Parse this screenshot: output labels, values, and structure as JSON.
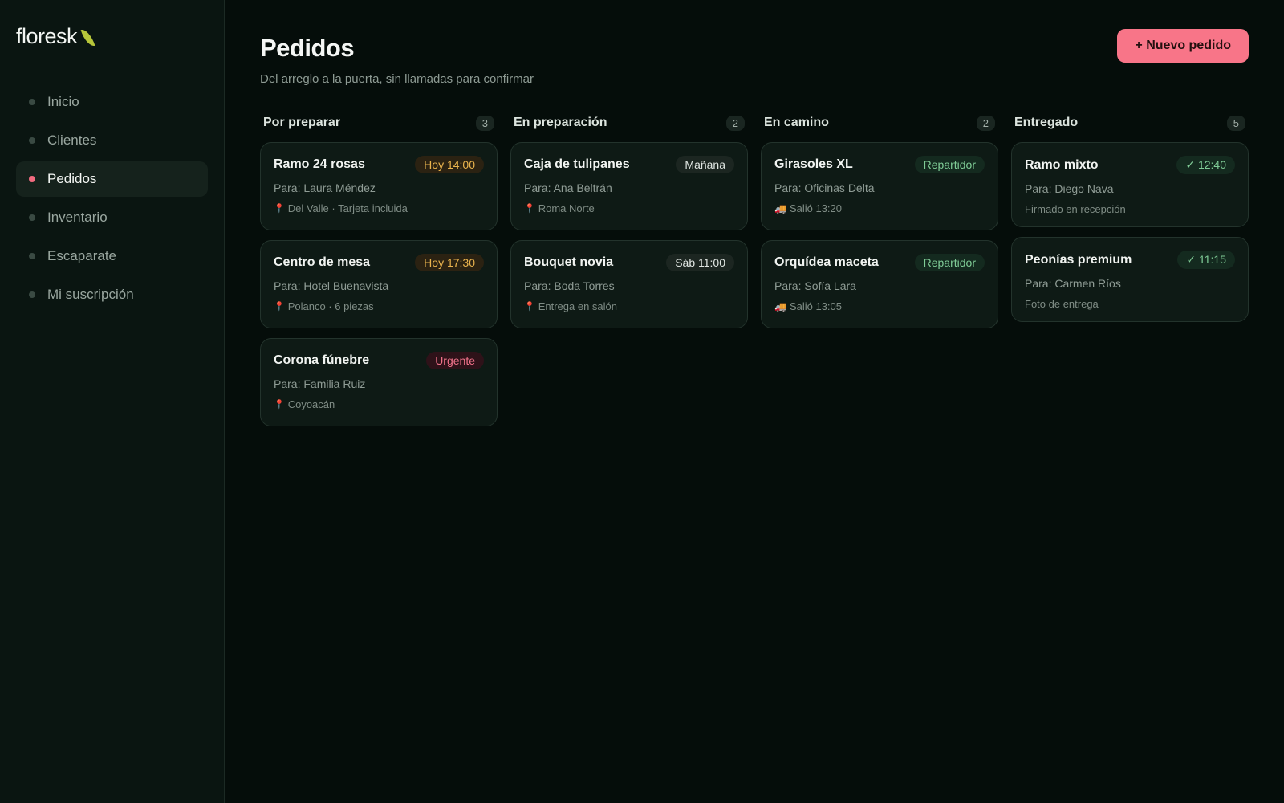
{
  "brand": {
    "name": "floresk"
  },
  "sidebar": {
    "items": [
      {
        "label": "Inicio"
      },
      {
        "label": "Clientes"
      },
      {
        "label": "Pedidos"
      },
      {
        "label": "Inventario"
      },
      {
        "label": "Escaparate"
      },
      {
        "label": "Mi suscripción"
      }
    ]
  },
  "header": {
    "title": "Pedidos",
    "subtitle": "Del arreglo a la puerta, sin llamadas para confirmar",
    "new_button": "+ Nuevo pedido"
  },
  "columns": [
    {
      "title": "Por preparar",
      "count": "3",
      "cards": [
        {
          "title": "Ramo 24 rosas",
          "badge": "Hoy 14:00",
          "to": "Para: Laura Méndez",
          "meta": "Del Valle · Tarjeta incluida"
        },
        {
          "title": "Centro de mesa",
          "badge": "Hoy 17:30",
          "to": "Para: Hotel Buenavista",
          "meta": "Polanco · 6 piezas"
        },
        {
          "title": "Corona fúnebre",
          "badge": "Urgente",
          "to": "Para: Familia Ruiz",
          "meta": "Coyoacán"
        }
      ]
    },
    {
      "title": "En preparación",
      "count": "2",
      "cards": [
        {
          "title": "Caja de tulipanes",
          "badge": "Mañana",
          "to": "Para: Ana Beltrán",
          "meta": "Roma Norte"
        },
        {
          "title": "Bouquet novia",
          "badge": "Sáb 11:00",
          "to": "Para: Boda Torres",
          "meta": "Entrega en salón"
        }
      ]
    },
    {
      "title": "En camino",
      "count": "2",
      "cards": [
        {
          "title": "Girasoles XL",
          "badge": "Repartidor",
          "to": "Para: Oficinas Delta",
          "meta": "Salió 13:20"
        },
        {
          "title": "Orquídea maceta",
          "badge": "Repartidor",
          "to": "Para: Sofía Lara",
          "meta": "Salió 13:05"
        }
      ]
    },
    {
      "title": "Entregado",
      "count": "5",
      "cards": [
        {
          "title": "Ramo mixto",
          "badge": "✓ 12:40",
          "to": "Para: Diego Nava",
          "meta": "Firmado en recepción"
        },
        {
          "title": "Peonías premium",
          "badge": "✓ 11:15",
          "to": "Para: Carmen Ríos",
          "meta": "Foto de entrega"
        }
      ]
    }
  ],
  "colors": {
    "accent": "#f87588",
    "amber": "#e9b34d",
    "green": "#7fcb96",
    "urgent": "#f0728a"
  }
}
